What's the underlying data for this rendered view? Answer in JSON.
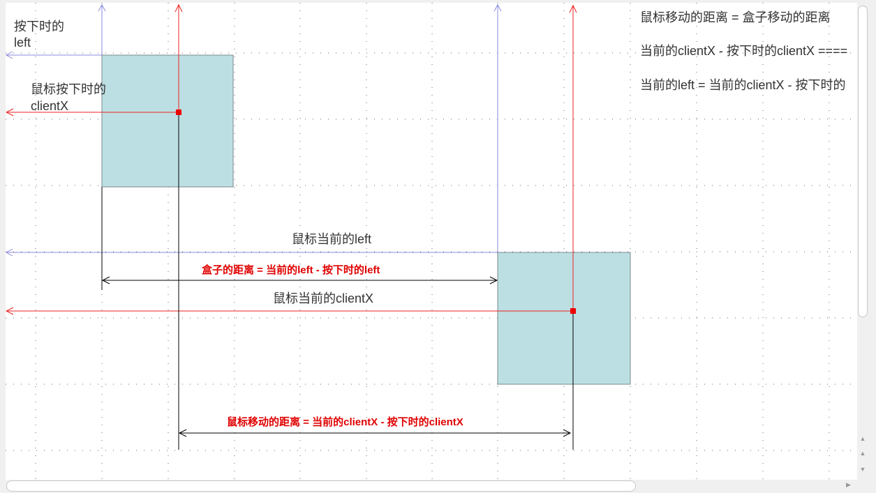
{
  "labels": {
    "press_left_line1": "按下时的",
    "press_left_line2": "left",
    "mouse_press_clientx_line1": "鼠标按下时的",
    "mouse_press_clientx_line2": "clientX",
    "mouse_current_left": "鼠标当前的left",
    "mouse_current_clientx": "鼠标当前的clientX",
    "box_distance_formula": "盒子的距离 = 当前的left - 按下时的left",
    "mouse_distance_formula": "鼠标移动的距离 = 当前的clientX - 按下时的clientX"
  },
  "notes": {
    "line1": "鼠标移动的距离 =  盒子移动的距离",
    "line2": "当前的clientX - 按下时的clientX ====",
    "line3": "当前的left = 当前的clientX - 按下时的"
  },
  "scroll_icons": {
    "up": "▲",
    "up2": "▲",
    "down": "▼",
    "right": "▶"
  },
  "colors": {
    "box_fill": "#bcdfe3",
    "red": "#ee2222",
    "blue": "#8888dd",
    "grid_dot": "#666666"
  }
}
